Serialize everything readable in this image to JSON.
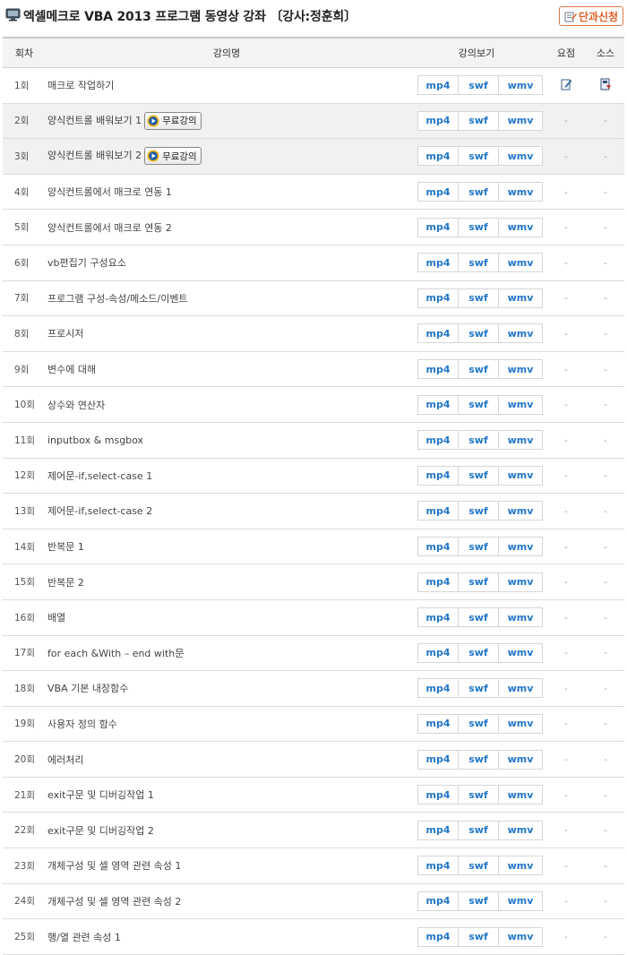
{
  "header": {
    "title": "엑셀메크로 VBA 2013 프로그램 동영상 강좌 〔강사:정훈희〕",
    "apply_label": "단과신청"
  },
  "columns": {
    "no": "회차",
    "title": "강의명",
    "view": "강의보기",
    "summary": "요점",
    "source": "소스"
  },
  "formats": [
    "mp4",
    "swf",
    "wmv"
  ],
  "free_label": "무료강의",
  "empty_mark": "-",
  "colors": {
    "accent": "#2276c9",
    "apply": "#e0612a"
  },
  "lectures": [
    {
      "no": "1회",
      "title": "매크로 작업하기",
      "free": false,
      "summary": "edit-icon",
      "source": "download-icon"
    },
    {
      "no": "2회",
      "title": "양식컨트롤 배워보기 1",
      "free": true
    },
    {
      "no": "3회",
      "title": "양식컨트롤 배워보기 2",
      "free": true
    },
    {
      "no": "4회",
      "title": "양식컨트롤에서 매크로 연동 1",
      "free": false
    },
    {
      "no": "5회",
      "title": "양식컨트롤에서 매크로 연동 2",
      "free": false
    },
    {
      "no": "6회",
      "title": "vb편집기 구성요소",
      "free": false
    },
    {
      "no": "7회",
      "title": "프로그램 구성-속성/메소드/이벤트",
      "free": false
    },
    {
      "no": "8회",
      "title": "프로시저",
      "free": false
    },
    {
      "no": "9회",
      "title": "변수에 대해",
      "free": false
    },
    {
      "no": "10회",
      "title": "상수와 연산자",
      "free": false
    },
    {
      "no": "11회",
      "title": "inputbox & msgbox",
      "free": false
    },
    {
      "no": "12회",
      "title": "제어문-if,select-case 1",
      "free": false
    },
    {
      "no": "13회",
      "title": "제어문-if,select-case 2",
      "free": false
    },
    {
      "no": "14회",
      "title": "반복문 1",
      "free": false
    },
    {
      "no": "15회",
      "title": "반복문 2",
      "free": false
    },
    {
      "no": "16회",
      "title": "배열",
      "free": false
    },
    {
      "no": "17회",
      "title": "for each &With – end with문",
      "free": false
    },
    {
      "no": "18회",
      "title": "VBA 기본 내장함수",
      "free": false
    },
    {
      "no": "19회",
      "title": "사용자 정의 함수",
      "free": false
    },
    {
      "no": "20회",
      "title": "에러처리",
      "free": false
    },
    {
      "no": "21회",
      "title": "exit구문 및 디버깅작업 1",
      "free": false
    },
    {
      "no": "22회",
      "title": "exit구문 및 디버깅작업 2",
      "free": false
    },
    {
      "no": "23회",
      "title": "개체구성 및 셀 영역 관련 속성 1",
      "free": false
    },
    {
      "no": "24회",
      "title": "개체구성 및 셀 영역 관련 속성 2",
      "free": false
    },
    {
      "no": "25회",
      "title": "행/열 관련 속성 1",
      "free": false
    }
  ]
}
